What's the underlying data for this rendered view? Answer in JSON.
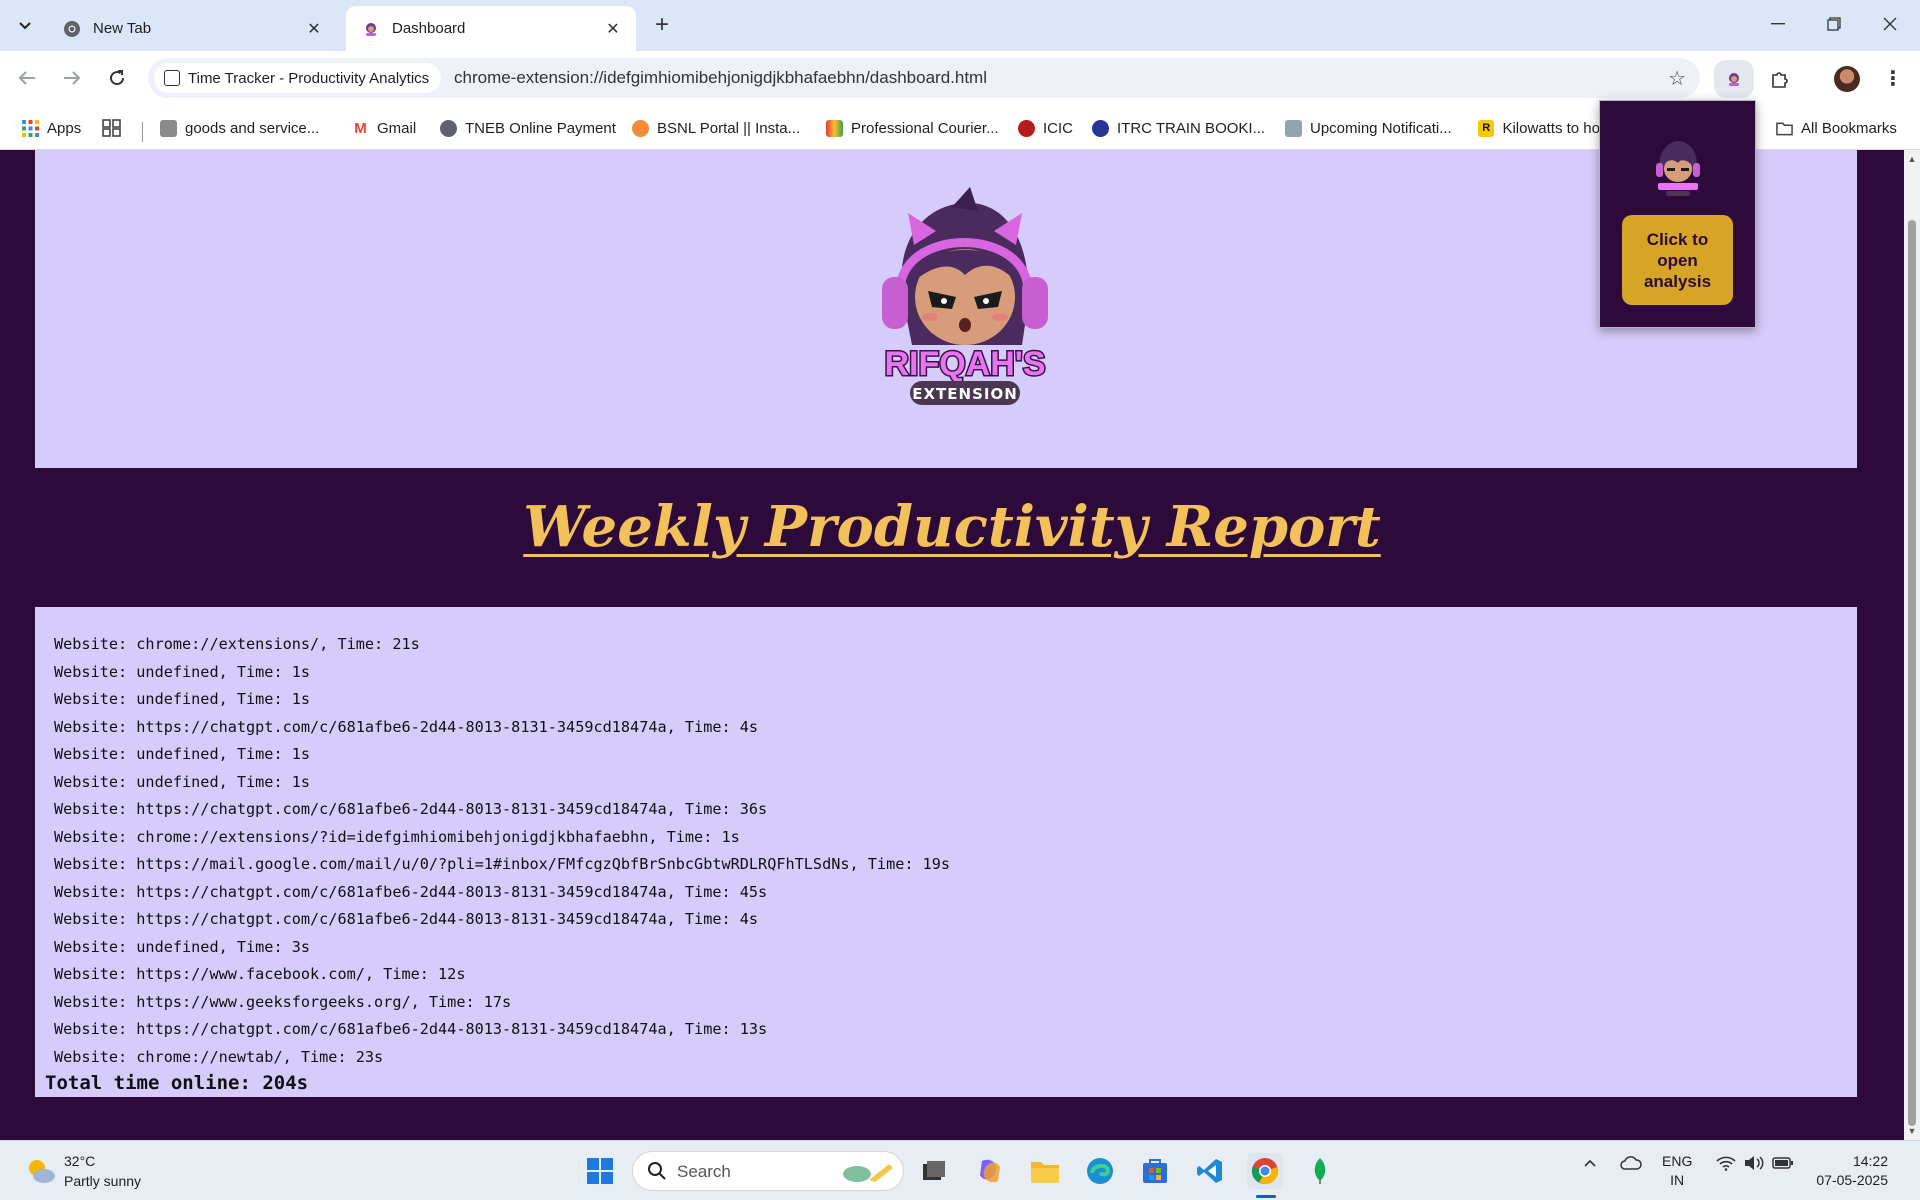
{
  "browser": {
    "tabs": [
      {
        "title": "New Tab",
        "icon": "chrome-icon"
      },
      {
        "title": "Dashboard",
        "icon": "extension-favicon",
        "active": true
      }
    ],
    "site_chip": "Time Tracker - Productivity Analytics",
    "url": "chrome-extension://idefgimhiomibehjonigdjkbhafaebhn/dashboard.html",
    "bookmarks": [
      {
        "label": "Apps",
        "icon": "apps-grid-icon"
      },
      {
        "label": "goods and service...",
        "icon": "gov-emblem-icon"
      },
      {
        "label": "Gmail",
        "icon": "gmail-icon"
      },
      {
        "label": "TNEB Online Payment",
        "icon": "globe-icon"
      },
      {
        "label": "BSNL Portal || Insta...",
        "icon": "bsnl-icon"
      },
      {
        "label": "Professional Courier...",
        "icon": "courier-icon"
      },
      {
        "label": "ICIC",
        "icon": "icici-icon"
      },
      {
        "label": "ITRC TRAIN BOOKI...",
        "icon": "irctc-icon"
      },
      {
        "label": "Upcoming Notificati...",
        "icon": "notification-icon"
      },
      {
        "label": "Kilowatts to ho",
        "icon": "r-icon"
      }
    ],
    "all_bookmarks": "All Bookmarks"
  },
  "page": {
    "title": "Weekly Productivity Report",
    "log_prefix": "Website",
    "entries": [
      "Website: chrome://extensions/, Time: 21s",
      "Website: undefined, Time: 1s",
      "Website: undefined, Time: 1s",
      "Website: https://chatgpt.com/c/681afbe6-2d44-8013-8131-3459cd18474a, Time: 4s",
      "Website: undefined, Time: 1s",
      "Website: undefined, Time: 1s",
      "Website: https://chatgpt.com/c/681afbe6-2d44-8013-8131-3459cd18474a, Time: 36s",
      "Website: chrome://extensions/?id=idefgimhiomibehjonigdjkbhafaebhn, Time: 1s",
      "Website: https://mail.google.com/mail/u/0/?pli=1#inbox/FMfcgzQbfBrSnbcGbtwRDLRQFhTLSdNs, Time: 19s",
      "Website: https://chatgpt.com/c/681afbe6-2d44-8013-8131-3459cd18474a, Time: 45s",
      "Website: https://chatgpt.com/c/681afbe6-2d44-8013-8131-3459cd18474a, Time: 4s",
      "Website: undefined, Time: 3s",
      "Website: https://www.facebook.com/, Time: 12s",
      "Website: https://www.geeksforgeeks.org/, Time: 17s",
      "Website: https://chatgpt.com/c/681afbe6-2d44-8013-8131-3459cd18474a, Time: 13s",
      "Website: chrome://newtab/, Time: 23s"
    ],
    "total": "Total time online: 204s",
    "logo_text": "RIFQAH'S",
    "logo_subtext": "EXTENSION"
  },
  "popup": {
    "button_label": "Click to open analysis"
  },
  "taskbar": {
    "temp": "32°C",
    "weather": "Partly sunny",
    "search_placeholder": "Search",
    "lang_line1": "ENG",
    "lang_line2": "IN",
    "time": "14:22",
    "date": "07-05-2025"
  },
  "colors": {
    "page_bg": "#2d0a3a",
    "panel_bg": "#d6ccfb",
    "title_gold": "#f2c15a",
    "popup_button": "#d6a526"
  }
}
